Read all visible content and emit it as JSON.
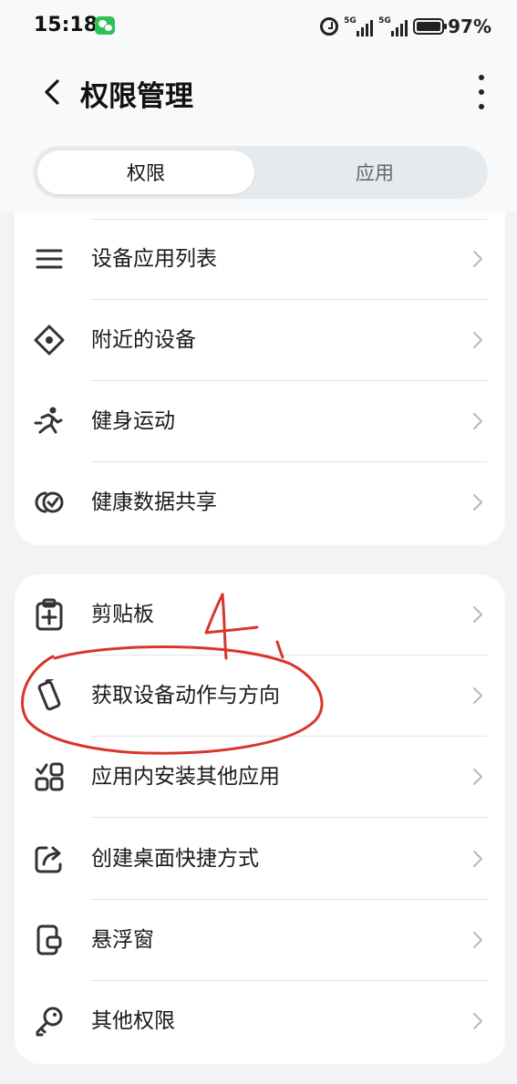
{
  "status_bar": {
    "time": "15:18",
    "network1": "5G",
    "network2": "5G",
    "battery": "97%",
    "icons": [
      "wechat-icon",
      "alarm-icon",
      "signal-icon",
      "battery-icon"
    ]
  },
  "header": {
    "title": "权限管理"
  },
  "tabs": [
    {
      "label": "权限",
      "selected": true
    },
    {
      "label": "应用",
      "selected": false
    }
  ],
  "group1": [
    {
      "label": "设备应用列表",
      "icon": "list-icon"
    },
    {
      "label": "附近的设备",
      "icon": "nearby-devices-icon"
    },
    {
      "label": "健身运动",
      "icon": "running-icon"
    },
    {
      "label": "健康数据共享",
      "icon": "health-share-icon"
    }
  ],
  "group2": [
    {
      "label": "剪贴板",
      "icon": "clipboard-icon"
    },
    {
      "label": "获取设备动作与方向",
      "icon": "device-motion-icon"
    },
    {
      "label": "应用内安装其他应用",
      "icon": "install-apps-icon"
    },
    {
      "label": "创建桌面快捷方式",
      "icon": "shortcut-icon"
    },
    {
      "label": "悬浮窗",
      "icon": "floating-window-icon"
    },
    {
      "label": "其他权限",
      "icon": "key-icon"
    }
  ],
  "annotation": {
    "text": "4.",
    "color": "#d9362b"
  },
  "colors": {
    "background": "#f1f3f5",
    "card": "#ffffff",
    "text": "#1a1a1a",
    "icon": "#333333",
    "chevron": "#b8b8b8"
  }
}
